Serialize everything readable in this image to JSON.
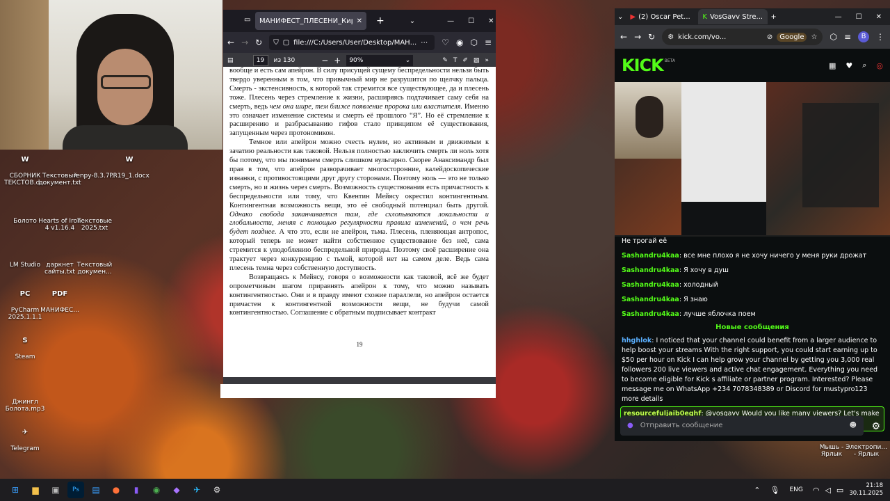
{
  "desktop": {
    "icons": [
      {
        "label": "СБОРНИК ТЕКСТОВ.d...",
        "color": "#2b579a",
        "glyph": "W"
      },
      {
        "label": "Текстовый документ.txt",
        "color": "#9fd3e6",
        "glyph": ""
      },
      {
        "label": "renpy-8.3.7...",
        "color": "#555",
        "glyph": ""
      },
      {
        "label": "PR19_1.docx",
        "color": "#2b579a",
        "glyph": "W"
      },
      {
        "label": "Болото",
        "color": "#4a6073",
        "glyph": ""
      },
      {
        "label": "Hearts of Iron 4 v1.16.4",
        "color": "#4a6073",
        "glyph": ""
      },
      {
        "label": "Текстовые 2025.txt",
        "color": "#9fd3e6",
        "glyph": ""
      },
      {
        "label": "LM Studio",
        "color": "#5b4bc4",
        "glyph": ""
      },
      {
        "label": "даркнет сайты.txt",
        "color": "#9fd3e6",
        "glyph": ""
      },
      {
        "label": "Текстовый докумен...",
        "color": "#9fd3e6",
        "glyph": ""
      },
      {
        "label": "PyCharm 2025.1.1.1",
        "color": "#1e8f58",
        "glyph": "PC"
      },
      {
        "label": "МАНИФЕС...",
        "color": "#d9342b",
        "glyph": "PDF"
      },
      {
        "label": "Steam",
        "color": "#1b2838",
        "glyph": "S"
      },
      {
        "label": "Джингл Болота.mp3",
        "color": "#555",
        "glyph": ""
      },
      {
        "label": "Telegram",
        "color": "#2aa3de",
        "glyph": "✈"
      }
    ],
    "right_icons": [
      {
        "label": "Мышь - Ярлык"
      },
      {
        "label": "Электропи... - Ярлык"
      }
    ]
  },
  "pdf": {
    "tab_title": "МАНИФЕСТ_ПЛЕСЕНИ_Кирилл_Н...",
    "url": "file:///C:/Users/User/Desktop/МАН...",
    "page": "19",
    "page_total": "из 130",
    "zoom": "90%",
    "page_number_footer": "19",
    "paragraphs": [
      {
        "text": "вообще и есть сам апейрон. В силу присущей сущему беспредельности нельзя быть твердо уверенным в том, что привычный мир не разрушится по щелчку пальца. Смерть - экстенсивность, к которой так стремится все существующее, да и плесень тоже. Плесень через стремление к жизни, расширяясь подтачивает саму себя на смерть, ведь ",
        "italic": "чем она шире, тем ближе появление пророка или властителя.",
        "rest": " Именно это означает изменение системы и смерть её прошлого “Я”. Но её стремление к расширению и разбрасыванию гифов стало принципом её существования, запущенным через протономикон."
      },
      {
        "text": "Темное или апейрон можно счесть нулем, но активным и движимым к зачатию реальности как таковой. Нельзя полностью заключить смерть ли ноль хотя бы потому, что мы понимаем смерть слишком вульгарно. Скорее Анаксимандр был прав в том, что апейрон разворачивает многосторонние, калейдоскопические изнанки, с противостоящими друг другу сторонами. Поэтому ноль — это не только смерть, но и жизнь через смерть. Возможность существования есть причастность к беспредельности или тому, что Квентин Мейясу окрестил контингентным. Контингентная возможность вещи, это её свободный потенциал быть другой. ",
        "italic": "Однако свобода заканчивается там, где схлопываются локальности и глобальности, меняя с помощью регулярности правила изменений, о чем речь будет позднее.",
        "rest": " А что это, если не апейрон, тьма. Плесень, пленяющая антропос, который теперь не может найти собственное существование без неё, сама стремится к уподоблению беспредельной природы. Поэтому своё расширение она трактует через конкуренцию с тьмой, которой нет на самом деле. Ведь сама плесень темна через собственную доступность."
      },
      {
        "text": "Возвращаясь к Мейясу, говоря о возможности как таковой, всё же будет опрометчивым шагом приравнять апейрон к тому, что можно называть контингентностью. Они и в правду имеют схожие параллели, но апейрон остается причастен к контингентной возможности вещи, не будучи самой контингентностью. Соглашение с обратным подписывает контракт",
        "italic": "",
        "rest": ""
      }
    ]
  },
  "chrome": {
    "tabs": [
      {
        "label": "(2) Oscar Pet..."
      },
      {
        "label": "VosGavv Stre..."
      }
    ],
    "url": "kick.com/vo...",
    "google_label": "Google",
    "profile_letter": "B",
    "logo": "KICK",
    "logo_beta": "BETA",
    "chat": {
      "top_cut": "Не трогай её",
      "messages": [
        {
          "user": "Sashandru4kaa",
          "text": "все мне плохо я не хочу ничего у меня руки дрожат"
        },
        {
          "user": "Sashandru4kaa",
          "text": "Я хочу в душ"
        },
        {
          "user": "Sashandru4kaa",
          "text": "холодный"
        },
        {
          "user": "Sashandru4kaa",
          "text": "Я знаю"
        },
        {
          "user": "Sashandru4kaa",
          "text": "лучше яблочка поем"
        }
      ],
      "new_label": "Новые сообщения",
      "spam": {
        "user": "hhghlok",
        "text": "I noticed that your channel could benefit from a larger audience to help boost your streams With the right support, you could start earning up to $50 per hour on Kick I can help grow your channel by getting you 3,000 real followers 200 live viewers and active chat engagement. Everything you need to become eligible for Kick s affiliate or partner program. Interested? Please message me on WhatsApp +234 7078348389 or Discord for mustypro123 more details"
      },
      "highlight": {
        "user": "resourcefuljaib0eghf",
        "text": "@vosgavv Would you like many viewers? Let's make you popular — https://nezhna.com"
      },
      "input_placeholder": "Отправить сообщение"
    }
  },
  "taskbar": {
    "lang": "ENG",
    "time": "21:18",
    "date": "30.11.2025"
  }
}
